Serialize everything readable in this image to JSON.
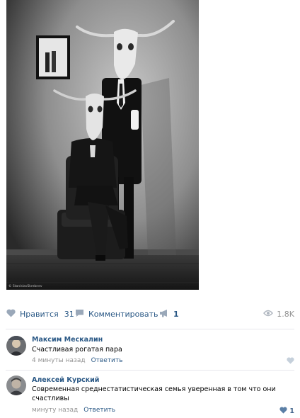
{
  "post": {
    "photo": {
      "watermark": "© StanislavSkrebnev"
    },
    "actions": {
      "like_label": "Нравится",
      "like_count": "31",
      "comment_label": "Комментировать",
      "share_count": "1",
      "views_count": "1.8K"
    }
  },
  "comments": [
    {
      "author": "Максим Мескалин",
      "text": "Счастливая рогатая пара",
      "time": "4 минуты назад",
      "reply_label": "Ответить",
      "likes": ""
    },
    {
      "author": "Алексей Курский",
      "text": "Современная среднестатистическая семья уверенная в том что они счастливы",
      "time": "минуту назад",
      "reply_label": "Ответить",
      "likes": "1"
    }
  ],
  "colors": {
    "link": "#2a5885",
    "muted": "#939393",
    "divider": "#e7e8ec",
    "icon": "#9aa8b9"
  }
}
